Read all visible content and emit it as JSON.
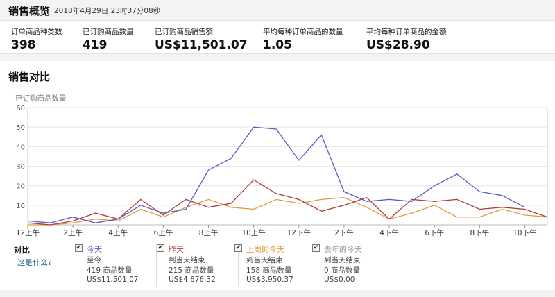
{
  "header": {
    "title": "销售概览",
    "timestamp": "2018年4月29日 23时37分08秒"
  },
  "metrics": [
    {
      "label": "订单商品种类数",
      "value": "398"
    },
    {
      "label": "已订购商品数量",
      "value": "419"
    },
    {
      "label": "已订购商品销售额",
      "value": "US$11,501.07"
    },
    {
      "label": "平均每种订单商品的数量",
      "value": "1.05"
    },
    {
      "label": "平均每种订单商品的金额",
      "value": "US$28.90"
    }
  ],
  "comparison": {
    "title": "销售对比",
    "compare_label": "对比",
    "help_link": "这是什么?",
    "legend": [
      {
        "name": "今天",
        "period": "至今",
        "units": "419 商品数量",
        "sales": "US$11,501.07",
        "color": "#5b58c4",
        "checked": true
      },
      {
        "name": "昨天",
        "period": "到当天结束",
        "units": "215 商品数量",
        "sales": "US$4,676.32",
        "color": "#b03a3a",
        "checked": true
      },
      {
        "name": "上周的今天",
        "period": "到当天结束",
        "units": "158 商品数量",
        "sales": "US$3,950.37",
        "color": "#e09a3a",
        "checked": true
      },
      {
        "name": "去年的今天",
        "period": "到当天结束",
        "units": "0 商品数量",
        "sales": "US$0.00",
        "color": "#aaaaaa",
        "checked": true
      }
    ]
  },
  "chart_data": {
    "type": "line",
    "ylabel": "已订购商品数量",
    "ylim": [
      0,
      60
    ],
    "yticks": [
      10,
      20,
      30,
      40,
      50,
      60
    ],
    "x": [
      0,
      1,
      2,
      3,
      4,
      5,
      6,
      7,
      8,
      9,
      10,
      11,
      12,
      13,
      14,
      15,
      16,
      17,
      18,
      19,
      20,
      21,
      22,
      23
    ],
    "xticks": [
      {
        "hour": 0,
        "label": "12上午"
      },
      {
        "hour": 2,
        "label": "2上午"
      },
      {
        "hour": 4,
        "label": "4上午"
      },
      {
        "hour": 6,
        "label": "6上午"
      },
      {
        "hour": 8,
        "label": "8上午"
      },
      {
        "hour": 10,
        "label": "10上午"
      },
      {
        "hour": 12,
        "label": "12下午"
      },
      {
        "hour": 14,
        "label": "2下午"
      },
      {
        "hour": 16,
        "label": "4下午"
      },
      {
        "hour": 18,
        "label": "6下午"
      },
      {
        "hour": 20,
        "label": "8下午"
      },
      {
        "hour": 22,
        "label": "10下午"
      }
    ],
    "series": [
      {
        "name": "今天",
        "color": "#5b58c4",
        "values": [
          2,
          1,
          4,
          1,
          3,
          10,
          6,
          8,
          28,
          34,
          50,
          49,
          33,
          46,
          17,
          12,
          13,
          12,
          20,
          26,
          17,
          15,
          9
        ]
      },
      {
        "name": "昨天",
        "color": "#b03a3a",
        "values": [
          1,
          0,
          2,
          6,
          3,
          13,
          5,
          13,
          9,
          11,
          23,
          16,
          13,
          7,
          10,
          14,
          3,
          13,
          12,
          13,
          8,
          9,
          8,
          4
        ]
      },
      {
        "name": "上周的今天",
        "color": "#e09a3a",
        "values": [
          0,
          0,
          1,
          3,
          2,
          8,
          4,
          9,
          13,
          9,
          8,
          13,
          11,
          13,
          14,
          9,
          3,
          6,
          10,
          4,
          4,
          8,
          5,
          4
        ]
      },
      {
        "name": "去年的今天",
        "color": "#aaaaaa",
        "values": [
          0,
          0,
          0,
          0,
          0,
          0,
          0,
          0,
          0,
          0,
          0,
          0,
          0,
          0,
          0,
          0,
          0,
          0,
          0,
          0,
          0,
          0,
          0,
          0
        ]
      }
    ]
  }
}
